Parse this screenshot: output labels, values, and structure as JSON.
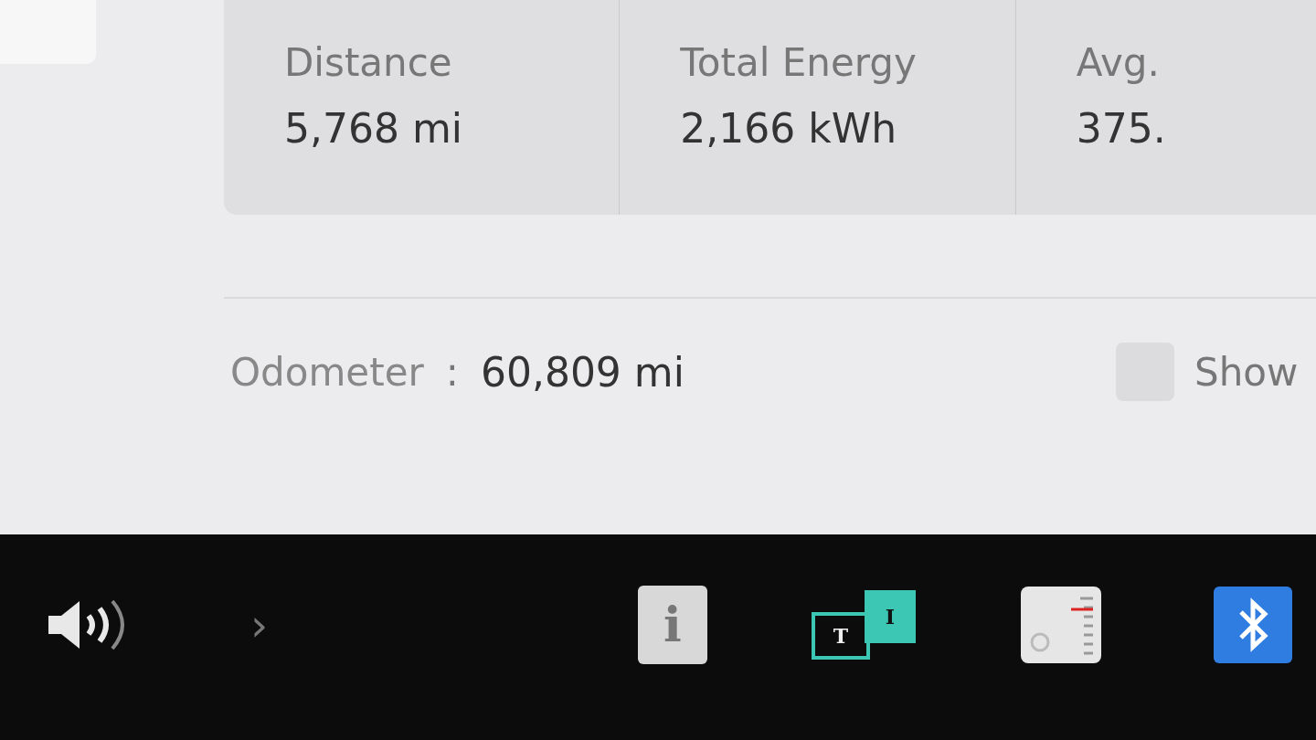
{
  "stats": [
    {
      "label": "Distance",
      "value": "5,768 mi"
    },
    {
      "label": "Total Energy",
      "value": "2,166 kWh"
    },
    {
      "label": "Avg.",
      "value": "375."
    }
  ],
  "odometer": {
    "label": "Odometer",
    "separator": ":",
    "value": "60,809 mi"
  },
  "show_option": {
    "label": "Show",
    "checked": false
  },
  "dock": {
    "chevron": "›",
    "items": [
      {
        "kind": "info",
        "glyph": "i"
      },
      {
        "kind": "toybox",
        "glyph": "T",
        "glyph_2": "I"
      },
      {
        "kind": "radio"
      },
      {
        "kind": "bluetooth"
      }
    ]
  }
}
